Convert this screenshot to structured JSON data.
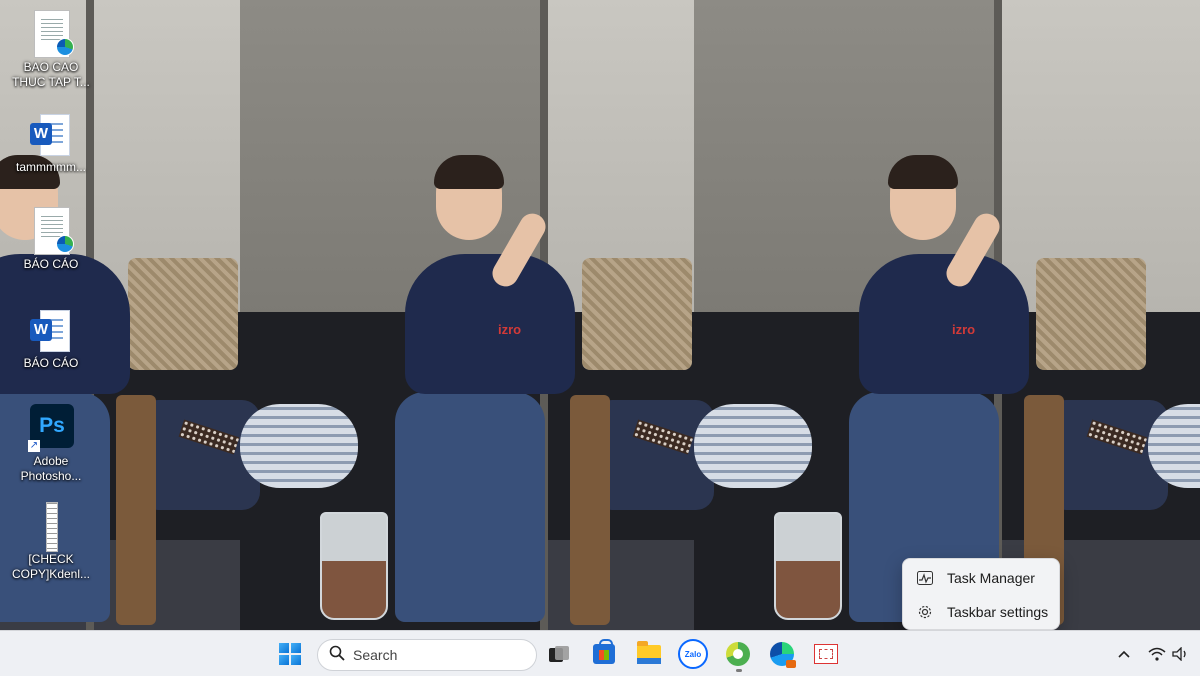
{
  "desktop": {
    "icons": [
      {
        "label": "BAO CAO THUC TAP T...",
        "type": "edge-document"
      },
      {
        "label": "tammmmm...",
        "type": "word-document"
      },
      {
        "label": "BÁO CÁO",
        "type": "edge-document"
      },
      {
        "label": "BÁO CÁO",
        "type": "word-document"
      },
      {
        "label": "Adobe Photosho...",
        "type": "photoshop-shortcut",
        "glyph": "Ps"
      },
      {
        "label": "[CHECK COPY]Kdenl...",
        "type": "text-file"
      }
    ]
  },
  "wallpaper": {
    "shirt_logo": "izro"
  },
  "context_menu": {
    "items": [
      {
        "label": "Task Manager",
        "icon": "task-manager-icon"
      },
      {
        "label": "Taskbar settings",
        "icon": "gear-icon"
      }
    ]
  },
  "taskbar": {
    "search_label": "Search",
    "apps": [
      "task-view",
      "microsoft-store",
      "file-explorer",
      "zalo",
      "app-leaf",
      "microsoft-edge",
      "snipping-tool"
    ],
    "zalo_label": "Zalo",
    "accent": "#0a74d6",
    "tray_icons": [
      "chevron-up-icon",
      "wifi-icon",
      "speaker-icon"
    ]
  }
}
